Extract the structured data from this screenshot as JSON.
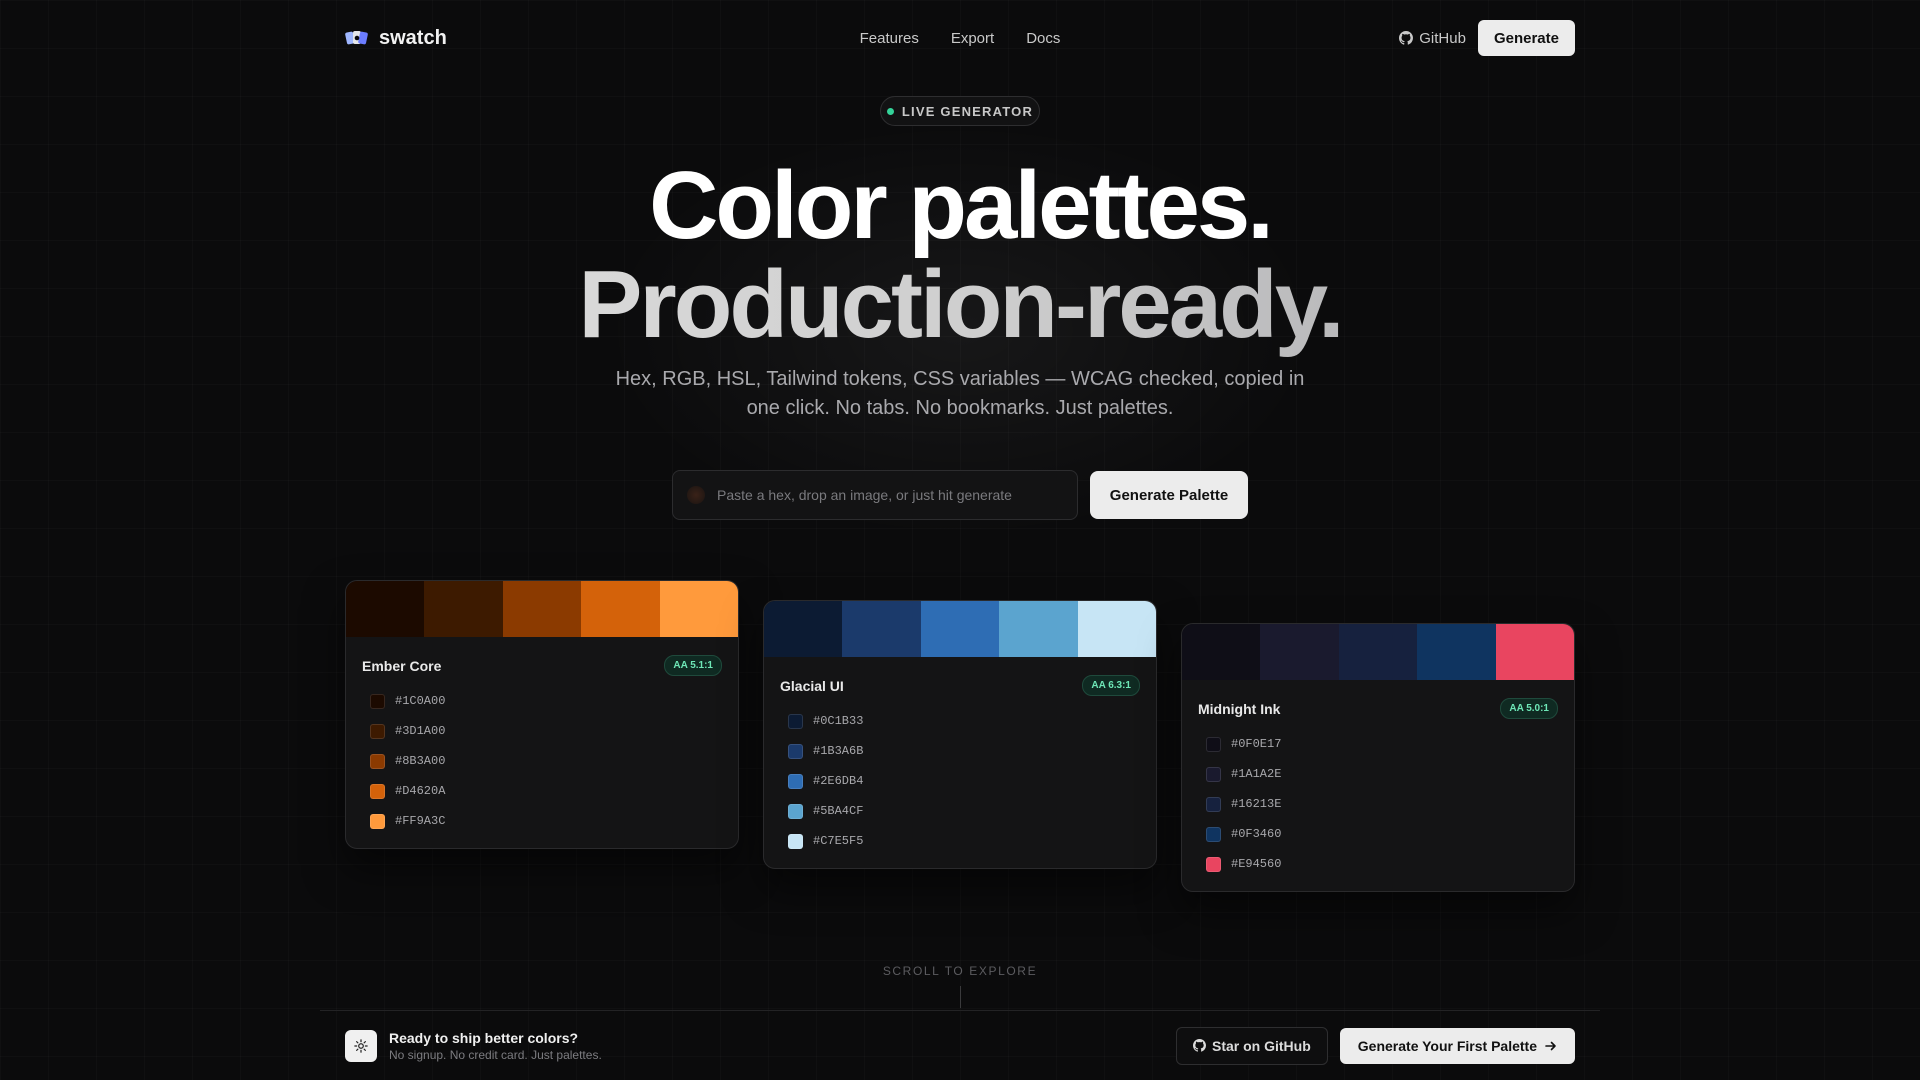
{
  "nav": {
    "brand": "swatch",
    "links": [
      "Features",
      "Export",
      "Docs"
    ],
    "github_label": "GitHub",
    "generate_label": "Generate"
  },
  "hero": {
    "badge": "LIVE GENERATOR",
    "title_line1": "Color palettes.",
    "title_line2": "Production-ready.",
    "subtitle": "Hex, RGB, HSL, Tailwind tokens, CSS variables — WCAG checked, copied in one click. No tabs. No bookmarks. Just palettes.",
    "input_placeholder": "Paste a hex, drop an image, or just hit generate",
    "input_value": "",
    "generate_button": "Generate Palette"
  },
  "palettes": [
    {
      "name": "Ember Core",
      "contrast": "AA 5.1:1",
      "colors": [
        "#1C0A00",
        "#3D1A00",
        "#8B3A00",
        "#D4620A",
        "#FF9A3C"
      ]
    },
    {
      "name": "Glacial UI",
      "contrast": "AA 6.3:1",
      "colors": [
        "#0C1B33",
        "#1B3A6B",
        "#2E6DB4",
        "#5BA4CF",
        "#C7E5F5"
      ]
    },
    {
      "name": "Midnight Ink",
      "contrast": "AA 5.0:1",
      "colors": [
        "#0F0E17",
        "#1A1A2E",
        "#16213E",
        "#0F3460",
        "#E94560"
      ]
    }
  ],
  "scroll_hint": "SCROLL TO EXPLORE",
  "cta": {
    "title": "Ready to ship better colors?",
    "subtitle": "No signup. No credit card. Just palettes.",
    "star_label": "Star on GitHub",
    "primary_label": "Generate Your First Palette"
  },
  "icons": {
    "logo": "swatch-logo-icon",
    "github": "github-icon",
    "arrow": "arrow-right-icon",
    "cta": "sun-icon"
  },
  "colors": {
    "background": "#0b0b0c",
    "accent_live": "#34d399",
    "button_light": "#ececec"
  }
}
